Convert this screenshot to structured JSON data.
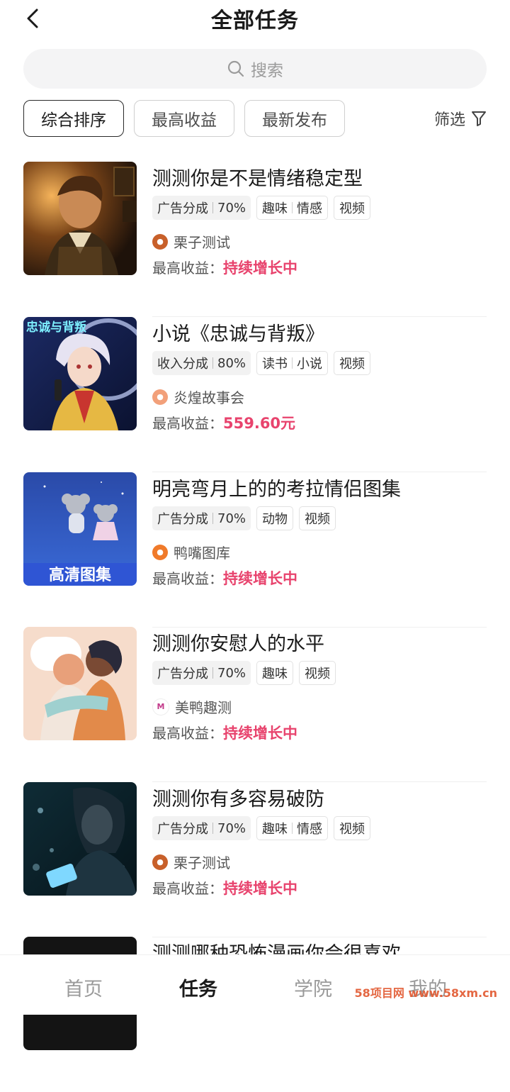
{
  "header": {
    "title": "全部任务"
  },
  "search": {
    "placeholder": "搜索"
  },
  "sort": {
    "options": [
      "综合排序",
      "最高收益",
      "最新发布"
    ],
    "filter_label": "筛选"
  },
  "earnings_label": "最高收益：",
  "tasks": [
    {
      "title": "测测你是不是情绪稳定型",
      "share_type": "广告分成",
      "share_pct": "70%",
      "tag_group": [
        "趣味",
        "情感"
      ],
      "media": "视频",
      "publisher": "栗子测试",
      "max_earnings": "持续增长中"
    },
    {
      "title": "小说《忠诚与背叛》",
      "share_type": "收入分成",
      "share_pct": "80%",
      "tag_group": [
        "读书",
        "小说"
      ],
      "media": "视频",
      "publisher": "炎煌故事会",
      "max_earnings": "559.60元",
      "thumb_text": "忠诚与背叛"
    },
    {
      "title": "明亮弯月上的的考拉情侣图集",
      "share_type": "广告分成",
      "share_pct": "70%",
      "tag_group": [
        "动物"
      ],
      "media": "视频",
      "publisher": "鸭嘴图库",
      "max_earnings": "持续增长中",
      "thumb_banner": "高清图集"
    },
    {
      "title": "测测你安慰人的水平",
      "share_type": "广告分成",
      "share_pct": "70%",
      "tag_group": [
        "趣味"
      ],
      "media": "视频",
      "publisher": "美鸭趣测",
      "max_earnings": "持续增长中"
    },
    {
      "title": "测测你有多容易破防",
      "share_type": "广告分成",
      "share_pct": "70%",
      "tag_group": [
        "趣味",
        "情感"
      ],
      "media": "视频",
      "publisher": "栗子测试",
      "max_earnings": "持续增长中"
    },
    {
      "title": "测测哪种恐怖漫画你会很喜欢"
    }
  ],
  "nav": {
    "items": [
      "首页",
      "任务",
      "学院",
      "我的"
    ],
    "active": "任务"
  },
  "watermark": "58项目网 www.58xm.cn",
  "colors": {
    "accent": "#e8436d",
    "text": "#1a1a1a",
    "muted": "#9a9a9a"
  }
}
